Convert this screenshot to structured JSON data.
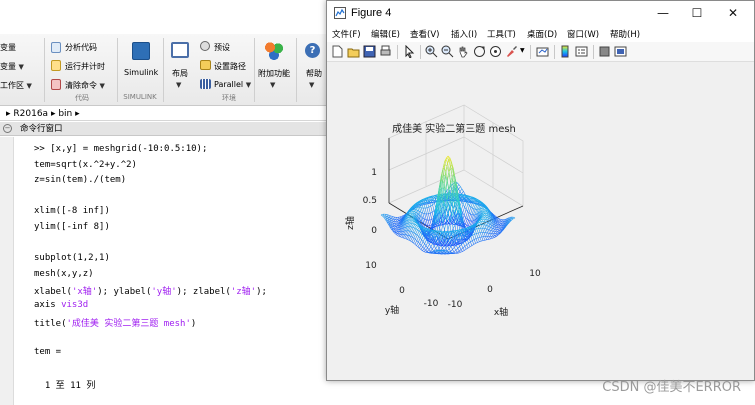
{
  "ribbon": {
    "left_items": [
      "变量",
      "变量",
      "工作区"
    ],
    "code_items": [
      "分析代码",
      "运行并计时",
      "清除命令"
    ],
    "group_code": "代码",
    "simulink_label": "Simulink",
    "group_simulink": "SIMULINK",
    "layout_label": "布局",
    "env_items": [
      "预设",
      "设置路径",
      "Parallel"
    ],
    "addons_label": "附加功能",
    "help_label": "帮助",
    "group_env": "环境"
  },
  "path_bar": {
    "segments": [
      "R2016a",
      "bin"
    ]
  },
  "command_window": {
    "header": "命令行窗口",
    "lines": [
      [
        {
          "t": ">> [x,y] = meshgrid(-10:0.5:10);"
        }
      ],
      [
        {
          "t": "tem=sqrt(x.^2+y.^2)"
        }
      ],
      [
        {
          "t": "z=sin(tem)./(tem)"
        }
      ],
      [
        {
          "t": ""
        }
      ],
      [
        {
          "t": "xlim([-8 inf])"
        }
      ],
      [
        {
          "t": "ylim([-inf 8])"
        }
      ],
      [
        {
          "t": ""
        }
      ],
      [
        {
          "t": "subplot(1,2,1)"
        }
      ],
      [
        {
          "t": "mesh(x,y,z)"
        }
      ],
      [
        {
          "t": "xlabel("
        },
        {
          "t": "'x轴'",
          "s": 1
        },
        {
          "t": "); ylabel("
        },
        {
          "t": "'y轴'",
          "s": 1
        },
        {
          "t": "); zlabel("
        },
        {
          "t": "'z轴'",
          "s": 1
        },
        {
          "t": ");"
        }
      ],
      [
        {
          "t": "axis "
        },
        {
          "t": "vis3d",
          "s": 1
        }
      ],
      [
        {
          "t": "title("
        },
        {
          "t": "'成佳美 实验二第三题 mesh'",
          "s": 1
        },
        {
          "t": ")"
        }
      ],
      [
        {
          "t": ""
        }
      ],
      [
        {
          "t": "tem ="
        }
      ],
      [
        {
          "t": ""
        }
      ],
      [
        {
          "t": "  1 至 11 列"
        }
      ]
    ]
  },
  "figure": {
    "title": "Figure 4",
    "menus": [
      "文件(F)",
      "编辑(E)",
      "查看(V)",
      "插入(I)",
      "工具(T)",
      "桌面(D)",
      "窗口(W)",
      "帮助(H)"
    ],
    "plot": {
      "title": "成佳美 实验二第三题 mesh",
      "xlabel": "x轴",
      "ylabel": "y轴",
      "zlabel": "z轴",
      "z_ticks": [
        "1",
        "0.5",
        "0"
      ],
      "y_ticks": [
        "10",
        "0",
        "-10"
      ],
      "x_ticks": [
        "-10",
        "0",
        "10"
      ],
      "accent_colors": [
        "#1f3cff",
        "#19c2e8",
        "#5fd88c",
        "#f2e82a"
      ]
    }
  },
  "watermark": "CSDN @佳美不ERROR"
}
